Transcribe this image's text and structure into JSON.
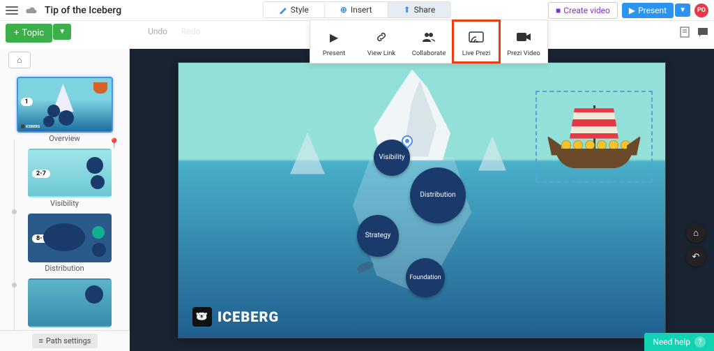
{
  "header": {
    "title": "Tip of the Iceberg",
    "tabs": {
      "style": "Style",
      "insert": "Insert",
      "share": "Share"
    },
    "create_video": "Create video",
    "present": "Present",
    "avatar_initials": "PO"
  },
  "share_menu": {
    "present": "Present",
    "view_link": "View Link",
    "collaborate": "Collaborate",
    "live_prezi": "Live Prezi",
    "prezi_video": "Prezi Video"
  },
  "toolbar": {
    "topic": "Topic",
    "undo": "Undo",
    "redo": "Redo"
  },
  "sidebar": {
    "thumbs": [
      {
        "badge": "1",
        "label": "Overview"
      },
      {
        "badge": "2-7",
        "label": "Visibility"
      },
      {
        "badge": "8-15",
        "label": "Distribution"
      }
    ],
    "path_settings": "Path settings"
  },
  "canvas": {
    "bubbles": {
      "visibility": "Visibility",
      "distribution": "Distribution",
      "strategy": "Strategy",
      "foundation": "Foundation"
    },
    "logo_text": "ICEBERG"
  },
  "footer": {
    "need_help": "Need help"
  }
}
